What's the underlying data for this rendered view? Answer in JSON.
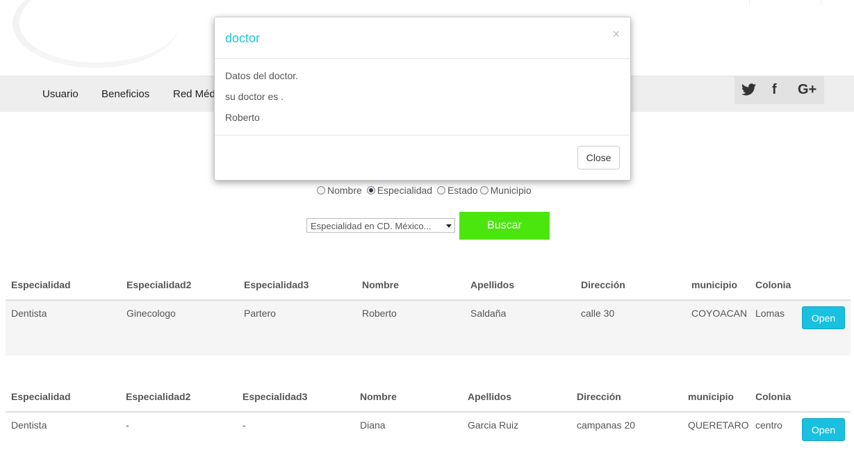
{
  "nav": {
    "items": [
      {
        "label": "Usuario"
      },
      {
        "label": "Beneficios"
      },
      {
        "label": "Red Médica"
      }
    ],
    "social": {
      "twitter": "🐦",
      "facebook": "f",
      "google_plus": "G+"
    }
  },
  "search": {
    "radios": [
      {
        "label": "Nombre",
        "checked": false
      },
      {
        "label": "Especialidad",
        "checked": true
      },
      {
        "label": "Estado",
        "checked": false
      },
      {
        "label": "Municipio",
        "checked": false
      }
    ],
    "select_value": "Especialidad en CD. México...",
    "button_label": "Buscar",
    "button_color": "#4ce60f"
  },
  "table1": {
    "headers": [
      "Especialidad",
      "Especialidad2",
      "Especialidad3",
      "Nombre",
      "Apellidos",
      "Dirección",
      "municipio",
      "Colonia"
    ],
    "row": [
      "Dentista",
      "Ginecologo",
      "Partero",
      "Roberto",
      "Saldaña",
      "calle 30",
      "COYOACAN",
      "Lomas"
    ],
    "button": "Open"
  },
  "table2": {
    "headers": [
      "Especialidad",
      "Especialidad2",
      "Especialidad3",
      "Nombre",
      "Apellidos",
      "Dirección",
      "municipio",
      "Colonia"
    ],
    "row": [
      "Dentista",
      "-",
      "-",
      "Diana",
      "Garcia Ruiz",
      "campanas 20",
      "QUERETARO",
      "centro"
    ],
    "button": "Open"
  },
  "modal": {
    "title": "doctor",
    "close_x": "×",
    "lines": [
      "Datos del doctor.",
      "su doctor es .",
      "Roberto"
    ],
    "close_button": "Close",
    "title_color": "#1cc7de"
  },
  "accent": {
    "open_button_color": "#19c0e0"
  }
}
